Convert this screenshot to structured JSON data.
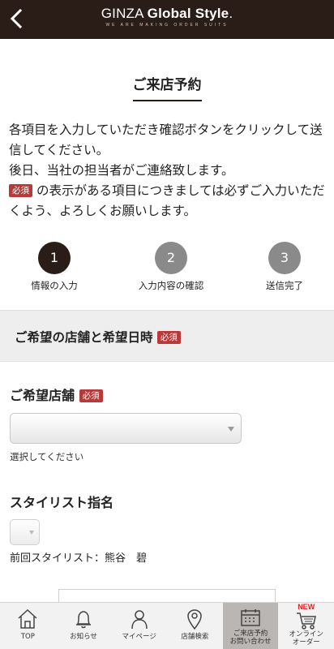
{
  "header": {
    "brand_part1": "GINZA ",
    "brand_part2": "Global Style",
    "brand_mark": ".",
    "tagline": "WE ARE MAKING ORDER SUITS",
    "back_icon": "chevron-left-icon"
  },
  "page_title": "ご来店予約",
  "intro": {
    "line1": "各項目を入力していただき確認ボタンをクリックして送信してください。",
    "line2": "後日、当社の担当者がご連絡致します。",
    "badge": "必須",
    "line3": "の表示がある項目につきましては必ずご入力いただくよう、よろしくお願いします。"
  },
  "steps": [
    {
      "number": "1",
      "label": "情報の入力",
      "active": true
    },
    {
      "number": "2",
      "label": "入力内容の確認",
      "active": false
    },
    {
      "number": "3",
      "label": "送信完了",
      "active": false
    }
  ],
  "section": {
    "title": "ご希望の店舗と希望日時",
    "badge": "必須"
  },
  "store_field": {
    "label": "ご希望店舗",
    "badge": "必須",
    "value": "",
    "hint": "選択してください"
  },
  "stylist_field": {
    "label": "スタイリスト指名",
    "value": "",
    "previous": "前回スタイリスト：熊谷　碧"
  },
  "tabbar": [
    {
      "label": "TOP",
      "icon": "home-icon"
    },
    {
      "label": "お知らせ",
      "icon": "bell-icon"
    },
    {
      "label": "マイページ",
      "icon": "person-icon"
    },
    {
      "label": "店舗検索",
      "icon": "map-pin-icon"
    },
    {
      "label": "ご来店予約",
      "label2": "お問い合わせ",
      "icon": "calendar-icon",
      "selected": true
    },
    {
      "label": "オンライン",
      "label2": "オーダー",
      "icon": "cart-icon",
      "badge": "NEW"
    }
  ],
  "colors": {
    "header_bg": "#2a1c17",
    "required_badge": "#b73a3a",
    "step_active": "#2a1c17",
    "step_inactive": "#8a8a8a",
    "tab_selected": "#b9b6b4"
  }
}
